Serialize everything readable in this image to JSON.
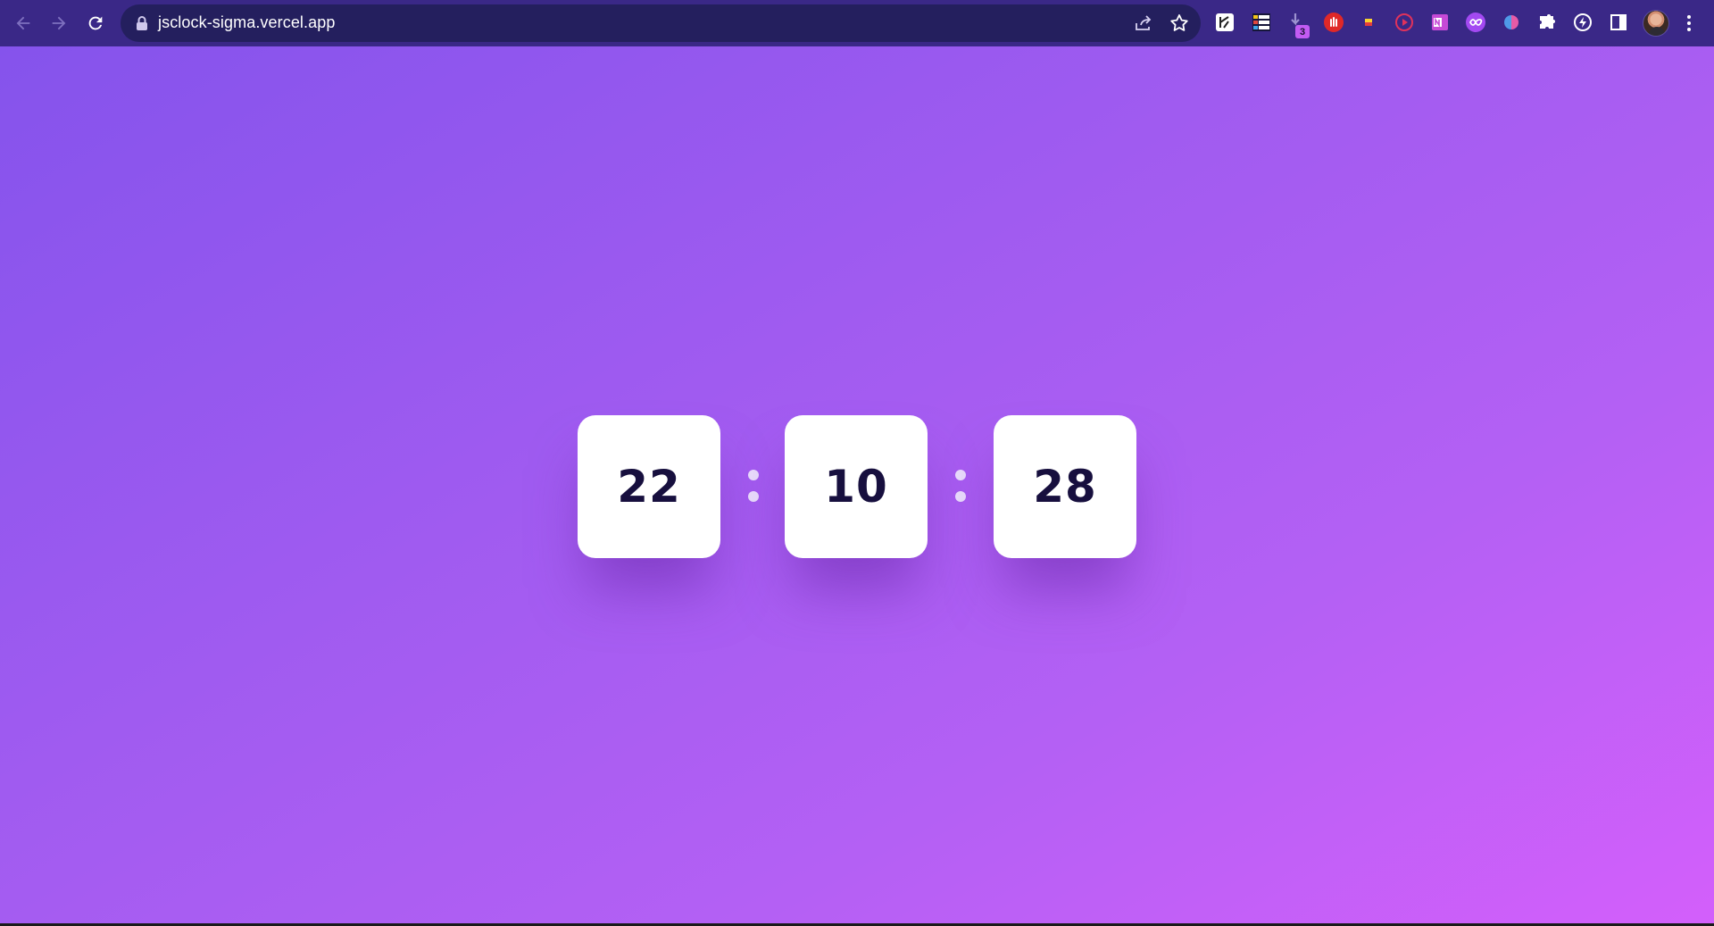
{
  "browser": {
    "url": "jsclock-sigma.vercel.app",
    "downloads_badge": "3",
    "toolbar_icons": [
      "back-icon",
      "forward-icon",
      "reload-icon",
      "lock-icon",
      "share-icon",
      "star-icon",
      "extension-icon",
      "extensions-puzzle-icon",
      "side-panel-icon",
      "profile-avatar",
      "more-menu-icon"
    ]
  },
  "clock": {
    "hours": "22",
    "minutes": "10",
    "seconds": "28"
  },
  "colors": {
    "toolbar": "#3a2887",
    "omnibox": "#241f5e",
    "gradient_start": "#8553ec",
    "gradient_end": "#d35ffb",
    "digit_text": "#170f3e",
    "digit_box": "#ffffff"
  }
}
